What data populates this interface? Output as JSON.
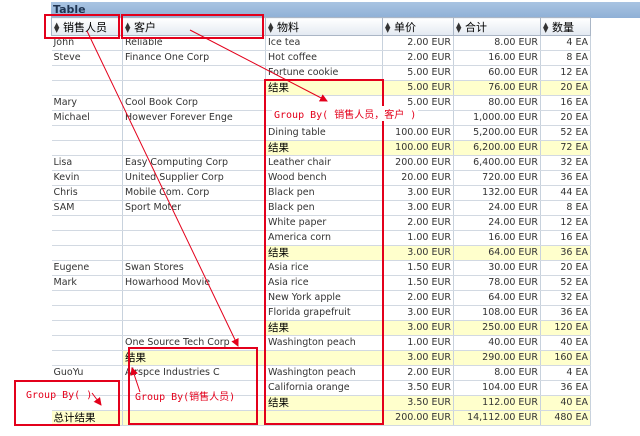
{
  "title": "Table",
  "columns": [
    "销售人员",
    "客户",
    "物料",
    "单价",
    "合计",
    "数量"
  ],
  "rows": [
    {
      "type": "row",
      "cells": [
        "John",
        "Reliable",
        "Ice tea",
        "2.00 EUR",
        "8.00 EUR",
        "4 EA"
      ]
    },
    {
      "type": "row",
      "cells": [
        "Steve",
        "Finance One Corp",
        "Hot coffee",
        "2.00 EUR",
        "16.00 EUR",
        "8 EA"
      ]
    },
    {
      "type": "row",
      "cells": [
        "",
        "",
        "Fortune cookie",
        "5.00 EUR",
        "60.00 EUR",
        "12 EA"
      ]
    },
    {
      "type": "sub",
      "cells": [
        "",
        "",
        "结果",
        "5.00 EUR",
        "76.00 EUR",
        "20 EA"
      ]
    },
    {
      "type": "row",
      "cells": [
        "Mary",
        "Cool Book Corp",
        "",
        "5.00 EUR",
        "80.00 EUR",
        "16 EA"
      ]
    },
    {
      "type": "row",
      "cells": [
        "Michael",
        "However Forever Enge",
        "",
        "",
        "1,000.00 EUR",
        "20 EA"
      ]
    },
    {
      "type": "row",
      "cells": [
        "",
        "",
        "Dining table",
        "100.00 EUR",
        "5,200.00 EUR",
        "52 EA"
      ]
    },
    {
      "type": "sub",
      "cells": [
        "",
        "",
        "结果",
        "100.00 EUR",
        "6,200.00 EUR",
        "72 EA"
      ]
    },
    {
      "type": "row",
      "cells": [
        "Lisa",
        "Easy Computing Corp",
        "Leather chair",
        "200.00 EUR",
        "6,400.00 EUR",
        "32 EA"
      ]
    },
    {
      "type": "row",
      "cells": [
        "Kevin",
        "United Supplier Corp",
        "Wood bench",
        "20.00 EUR",
        "720.00 EUR",
        "36 EA"
      ]
    },
    {
      "type": "row",
      "cells": [
        "Chris",
        "Mobile Com. Corp",
        "Black pen",
        "3.00 EUR",
        "132.00 EUR",
        "44 EA"
      ]
    },
    {
      "type": "row",
      "cells": [
        "SAM",
        "Sport Moter",
        "Black pen",
        "3.00 EUR",
        "24.00 EUR",
        "8 EA"
      ]
    },
    {
      "type": "row",
      "cells": [
        "",
        "",
        "White paper",
        "2.00 EUR",
        "24.00 EUR",
        "12 EA"
      ]
    },
    {
      "type": "row",
      "cells": [
        "",
        "",
        "America corn",
        "1.00 EUR",
        "16.00 EUR",
        "16 EA"
      ]
    },
    {
      "type": "sub",
      "cells": [
        "",
        "",
        "结果",
        "3.00 EUR",
        "64.00 EUR",
        "36 EA"
      ]
    },
    {
      "type": "row",
      "cells": [
        "Eugene",
        "Swan Stores",
        "Asia rice",
        "1.50 EUR",
        "30.00 EUR",
        "20 EA"
      ]
    },
    {
      "type": "row",
      "cells": [
        "Mark",
        "Howarhood Movie",
        "Asia rice",
        "1.50 EUR",
        "78.00 EUR",
        "52 EA"
      ]
    },
    {
      "type": "row",
      "cells": [
        "",
        "",
        "New York apple",
        "2.00 EUR",
        "64.00 EUR",
        "32 EA"
      ]
    },
    {
      "type": "row",
      "cells": [
        "",
        "",
        "Florida grapefruit",
        "3.00 EUR",
        "108.00 EUR",
        "36 EA"
      ]
    },
    {
      "type": "sub",
      "cells": [
        "",
        "",
        "结果",
        "3.00 EUR",
        "250.00 EUR",
        "120 EA"
      ]
    },
    {
      "type": "row",
      "cells": [
        "",
        "One Source Tech Corp",
        "Washington peach",
        "1.00 EUR",
        "40.00 EUR",
        "40 EA"
      ]
    },
    {
      "type": "sub",
      "cells": [
        "",
        "结果",
        "",
        "3.00 EUR",
        "290.00 EUR",
        "160 EA"
      ]
    },
    {
      "type": "row",
      "cells": [
        "GuoYu",
        "Airspce Industries C",
        "Washington peach",
        "2.00 EUR",
        "8.00 EUR",
        "4 EA"
      ]
    },
    {
      "type": "row",
      "cells": [
        "",
        "",
        "California orange",
        "3.50 EUR",
        "104.00 EUR",
        "36 EA"
      ]
    },
    {
      "type": "sub",
      "cells": [
        "",
        "",
        "结果",
        "3.50 EUR",
        "112.00 EUR",
        "40 EA"
      ]
    },
    {
      "type": "total",
      "cells": [
        "总计结果",
        "",
        "",
        "200.00 EUR",
        "14,112.00 EUR",
        "480 EA"
      ]
    }
  ],
  "annotations": {
    "group_by_customer": "Group By( 销售人员，客户 )",
    "group_by_salesperson": "Group By(销售人员)",
    "group_by_none": "Group By( )"
  },
  "colors": {
    "accent": "#e3001b",
    "subtotal": "#ffffcc",
    "header": "#9ab8dc"
  }
}
